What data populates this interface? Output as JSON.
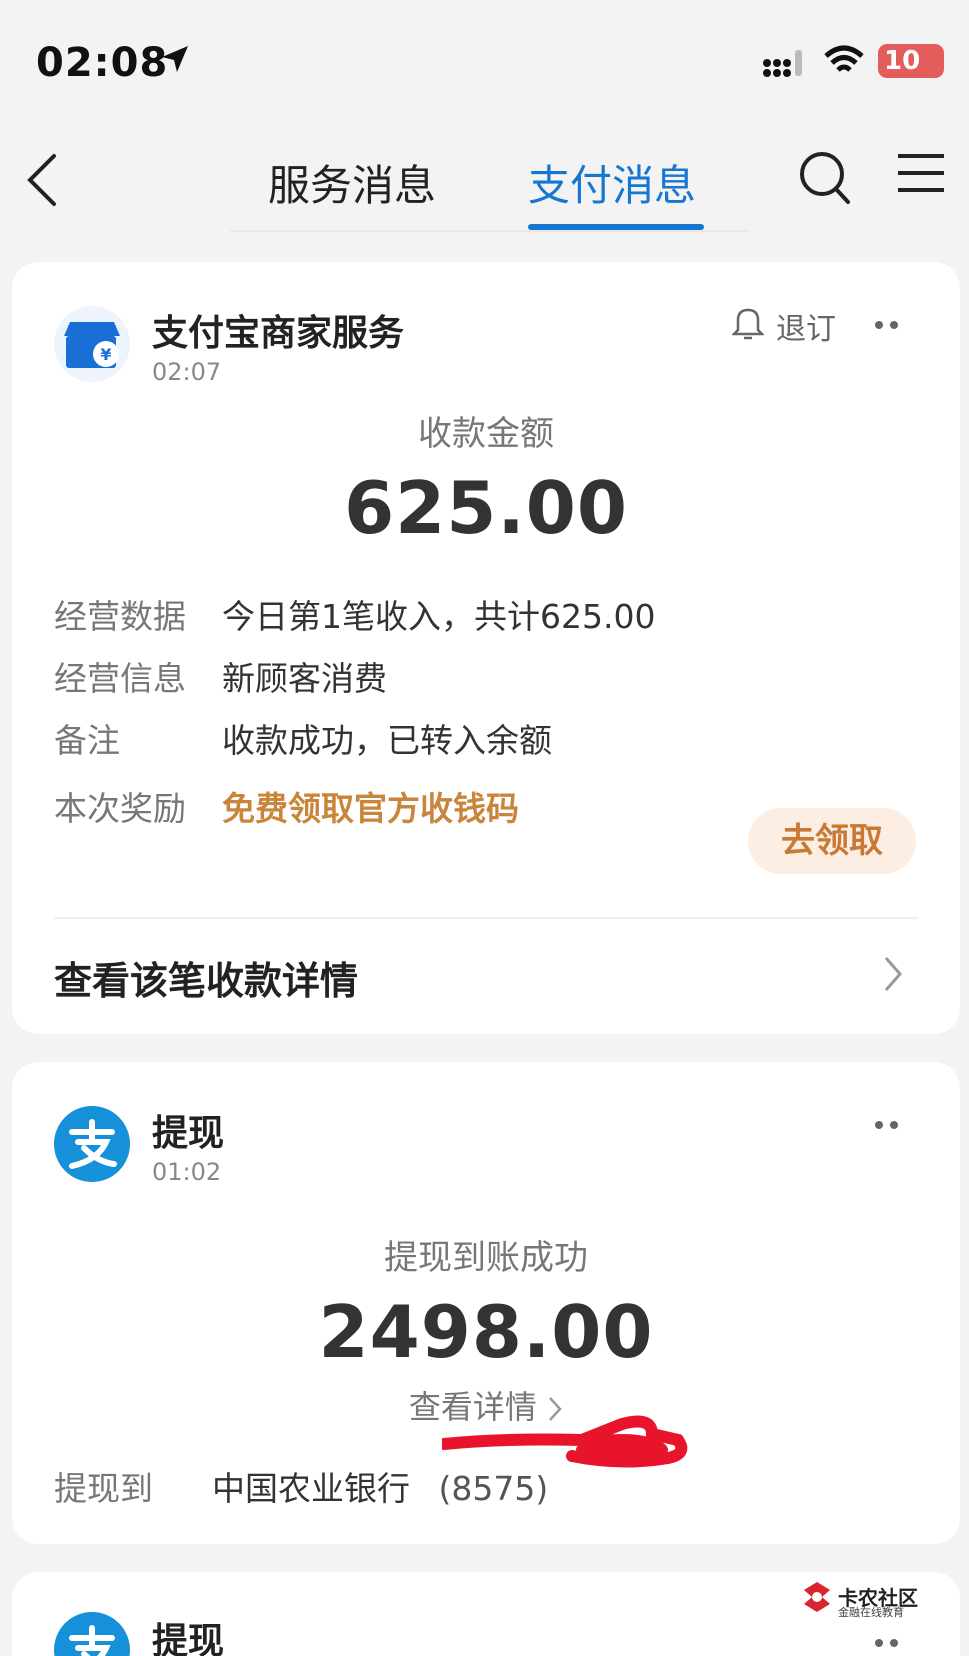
{
  "status_bar": {
    "time": "02:08",
    "battery": "10"
  },
  "nav": {
    "tab_service": "服务消息",
    "tab_payment": "支付消息",
    "accent": "#1677d2"
  },
  "card1": {
    "title": "支付宝商家服务",
    "time": "02:07",
    "unsubscribe": "退订",
    "amount_label": "收款金额",
    "amount": "625.00",
    "rows": [
      {
        "key": "经营数据",
        "value": "今日第1笔收入，共计625.00"
      },
      {
        "key": "经营信息",
        "value": "新顾客消费"
      },
      {
        "key": "备注",
        "value": "收款成功，已转入余额"
      },
      {
        "key": "本次奖励",
        "value": "免费领取官方收钱码"
      }
    ],
    "claim_button": "去领取",
    "detail_link": "查看该笔收款详情"
  },
  "card2": {
    "title": "提现",
    "time": "01:02",
    "amount_label": "提现到账成功",
    "amount": "2498.00",
    "view_detail": "查看详情",
    "row_key": "提现到",
    "row_value": "中国农业银行",
    "row_suffix": "(8575)"
  },
  "card3": {
    "title": "提现"
  },
  "watermark": {
    "title": "卡农社区",
    "subtitle": "金融在线教育"
  }
}
